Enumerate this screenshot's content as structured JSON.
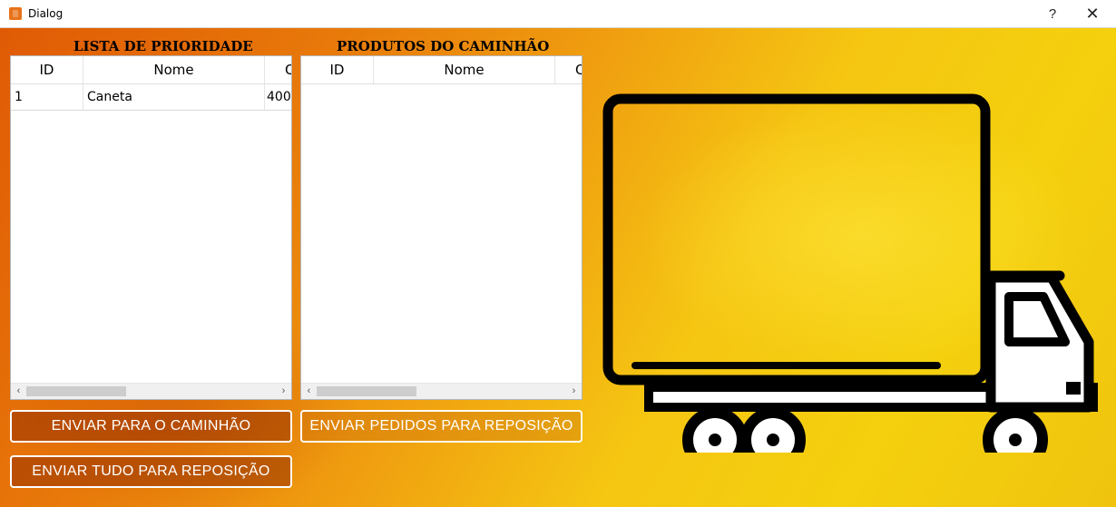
{
  "window": {
    "title": "Dialog",
    "help_label": "?",
    "close_label": "✕"
  },
  "priority": {
    "title": "LISTA DE PRIORIDADE",
    "columns": [
      "ID",
      "Nome",
      "Q"
    ],
    "rows": [
      {
        "id": "1",
        "nome": "Caneta",
        "qtd": "400"
      }
    ]
  },
  "truck_products": {
    "title": "PRODUTOS DO CAMINHÃO",
    "columns": [
      "ID",
      "Nome",
      "Q"
    ],
    "rows": []
  },
  "buttons": {
    "send_truck": "ENVIAR PARA O CAMINHÃO",
    "send_orders_restock": "ENVIAR PEDIDOS PARA REPOSIÇÃO",
    "send_all_restock": "ENVIAR TUDO PARA REPOSIÇÃO"
  },
  "scroll_arrows": {
    "left": "‹",
    "right": "›"
  },
  "icons": {
    "app": "app-icon",
    "truck": "truck-icon"
  },
  "colors": {
    "accent_orange": "#e87a0a",
    "accent_yellow": "#f4d00e"
  }
}
